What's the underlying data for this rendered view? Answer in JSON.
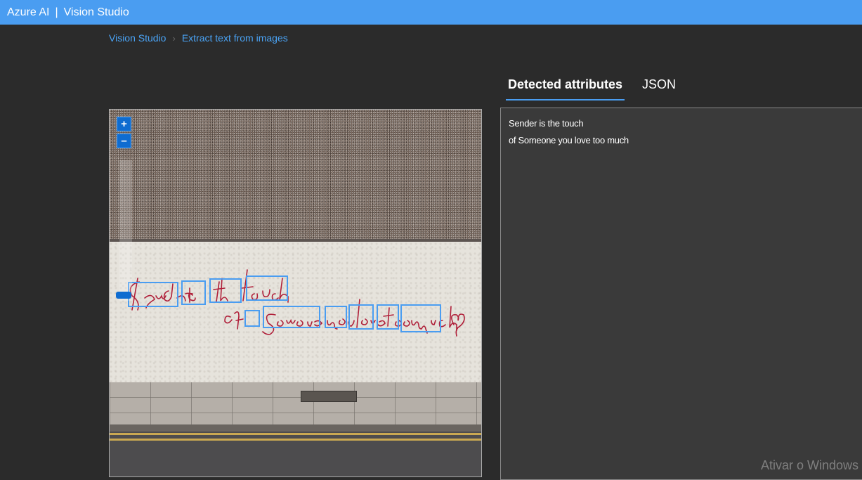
{
  "topbar": {
    "brand": "Azure AI",
    "separator": "|",
    "product": "Vision Studio"
  },
  "breadcrumb": {
    "home": "Vision Studio",
    "current": "Extract text from images"
  },
  "tabs": [
    {
      "label": "Detected attributes",
      "active": true
    },
    {
      "label": "JSON",
      "active": false
    }
  ],
  "image": {
    "zoom_in": "+",
    "zoom_out": "–",
    "words_line1": [
      "Sender",
      "is",
      "the",
      "touch"
    ],
    "words_line2": [
      "of",
      "Someone",
      "you",
      "love",
      "too",
      "much"
    ]
  },
  "results": {
    "lines": [
      "Sender is the touch",
      "of Someone you love too much"
    ]
  },
  "watermark": "Ativar o Windows",
  "colors": {
    "accent": "#4a9df1",
    "zoom_button": "#0f6cd0",
    "handwriting": "#b0203a"
  }
}
